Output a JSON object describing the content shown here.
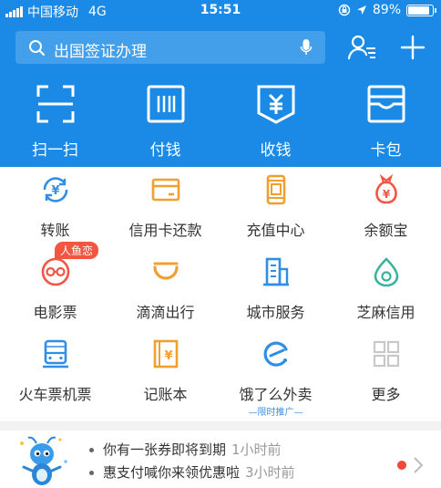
{
  "status_bar": {
    "carrier": "中国移动",
    "network": "4G",
    "time": "15:51",
    "battery": "89%",
    "battery_level": 0.89
  },
  "header": {
    "search_placeholder": "出国签证办理",
    "icons": [
      "search-icon",
      "microphone-icon",
      "contacts-icon",
      "add-icon"
    ]
  },
  "top_actions": [
    {
      "label": "扫一扫",
      "icon": "scan-icon"
    },
    {
      "label": "付钱",
      "icon": "pay-barcode-icon"
    },
    {
      "label": "收钱",
      "icon": "collect-money-icon"
    },
    {
      "label": "卡包",
      "icon": "card-wallet-icon"
    }
  ],
  "services": [
    {
      "label": "转账",
      "icon": "transfer-icon",
      "color": "#2f8ee5"
    },
    {
      "label": "信用卡还款",
      "icon": "credit-card-icon",
      "color": "#f0a030"
    },
    {
      "label": "充值中心",
      "icon": "phone-recharge-icon",
      "color": "#f0a030"
    },
    {
      "label": "余额宝",
      "icon": "money-bag-icon",
      "color": "#f25643"
    },
    {
      "label": "电影票",
      "icon": "movie-glasses-icon",
      "color": "#f25643",
      "badge": "人鱼恋"
    },
    {
      "label": "滴滴出行",
      "icon": "didi-icon",
      "color": "#f0a030"
    },
    {
      "label": "城市服务",
      "icon": "city-building-icon",
      "color": "#2f8ee5"
    },
    {
      "label": "芝麻信用",
      "icon": "sesame-credit-icon",
      "color": "#3ab39e"
    },
    {
      "label": "火车票机票",
      "icon": "train-icon",
      "color": "#2f8ee5"
    },
    {
      "label": "记账本",
      "icon": "account-book-icon",
      "color": "#f0a030"
    },
    {
      "label": "饿了么外卖",
      "icon": "eleme-icon",
      "color": "#2f8ee5",
      "promo": "—限时推广—"
    },
    {
      "label": "更多",
      "icon": "more-grid-icon",
      "color": "#c8c8c8"
    }
  ],
  "notices": [
    {
      "text": "你有一张券即将到期",
      "time": "1小时前"
    },
    {
      "text": "惠支付喊你来领优惠啦",
      "time": "3小时前"
    }
  ],
  "colors": {
    "brand_blue": "#1a8ae6",
    "notice_dot": "#f5483a"
  }
}
